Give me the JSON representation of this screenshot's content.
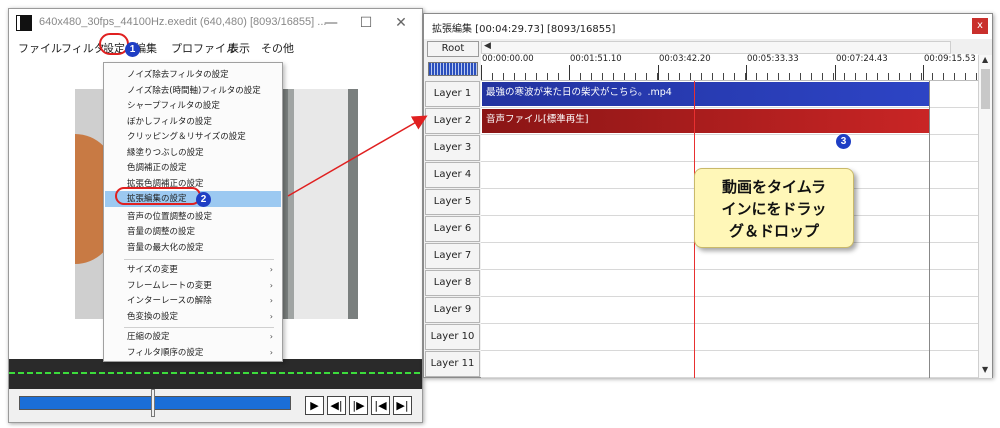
{
  "main_window": {
    "title": "640x480_30fps_44100Hz.exedit (640,480)  [8093/16855] ...",
    "controls": {
      "minimize": "—",
      "maximize": "☐",
      "close": "✕"
    },
    "menu": [
      "ファイル",
      "フィルタ",
      "設定",
      "編集",
      "プロファイル",
      "表示",
      "その他"
    ],
    "player_buttons": [
      "▶",
      "◀|",
      "|▶",
      "|◀",
      "▶|"
    ]
  },
  "context_menu": {
    "group1": [
      "ノイズ除去フィルタの設定",
      "ノイズ除去(時間軸)フィルタの設定",
      "シャープフィルタの設定",
      "ぼかしフィルタの設定",
      "クリッピング＆リサイズの設定",
      "縁塗りつぶしの設定",
      "色調補正の設定",
      "拡張色調補正の設定",
      "拡張編集の設定",
      "音声の位置調整の設定",
      "音量の調整の設定",
      "音量の最大化の設定"
    ],
    "group2": [
      "サイズの変更",
      "フレームレートの変更",
      "インターレースの解除",
      "色変換の設定"
    ],
    "group3": [
      "圧縮の設定",
      "フィルタ順序の設定"
    ],
    "submenu_arrow": "›"
  },
  "badges": [
    "1",
    "2",
    "3"
  ],
  "ext_window": {
    "title": "拡張編集 [00:04:29.73] [8093/16855]",
    "close": "x",
    "root_label": "Root",
    "scroll_left": "◀",
    "scroll_up": "▲",
    "scroll_down": "▼",
    "ruler_labels": [
      "00:00:00.00",
      "00:01:51.10",
      "00:03:42.20",
      "00:05:33.33",
      "00:07:24.43",
      "00:09:15.53"
    ],
    "layers": [
      "Layer 1",
      "Layer 2",
      "Layer 3",
      "Layer 4",
      "Layer 5",
      "Layer 6",
      "Layer 7",
      "Layer 8",
      "Layer 9",
      "Layer 10",
      "Layer 11"
    ],
    "clips": {
      "video": "最強の寒波が来た日の柴犬がこちら。.mp4",
      "audio": "音声ファイル[標準再生]"
    }
  },
  "callout": {
    "line1": "動画をタイムラ",
    "line2": "インにをドラッ",
    "line3": "グ＆ドロップ"
  },
  "colors": {
    "video_clip": "#2d44c5",
    "audio_clip": "#c92525",
    "badge": "#1e3ec4",
    "highlight": "#9cc9f1",
    "arrow": "#e02020"
  }
}
